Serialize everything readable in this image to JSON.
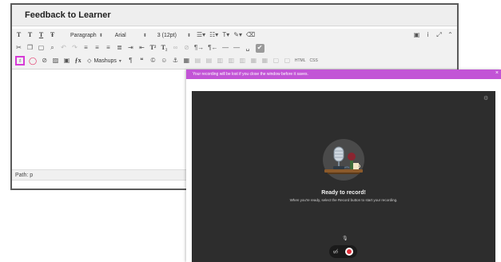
{
  "editor": {
    "title": "Feedback to Learner",
    "status_path": "Path: p",
    "toolbar": {
      "row1": {
        "format_btns": [
          "T",
          "T",
          "T",
          "Ŧ"
        ],
        "paragraph": "Paragraph",
        "font": "Arial",
        "size": "3 (12pt)"
      },
      "row3": {
        "mashups": "Mashups",
        "html_label": "HTML",
        "css_label": "CSS"
      }
    }
  },
  "recorder": {
    "banner": "Your recording will be lost if you close the window before it saves.",
    "ready_title": "Ready to record!",
    "ready_sub": "When you're ready, select the Record button to start your recording.",
    "colors": {
      "banner": "#c254d6",
      "stage": "#2d2d2d",
      "record": "#e0303a",
      "highlight": "#d63bd6"
    }
  }
}
